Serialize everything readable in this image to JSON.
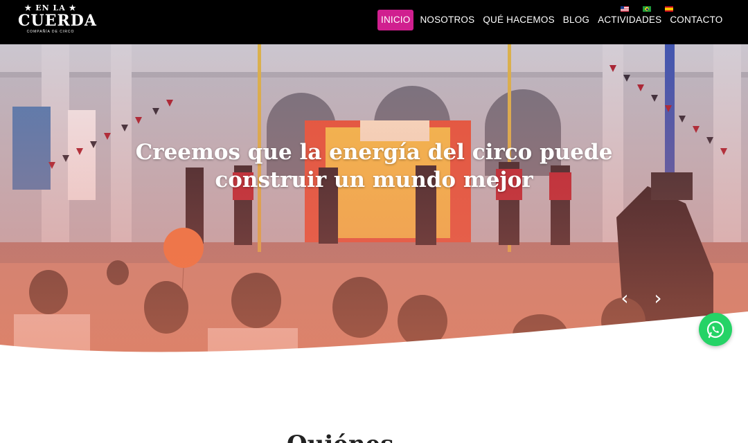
{
  "brand": {
    "logo_top": "★ EN LA ★",
    "logo_main": "CUERDA",
    "logo_sub": "COMPAÑÍA DE CIRCO"
  },
  "nav": {
    "items": [
      {
        "label": "INICIO",
        "active": true
      },
      {
        "label": "NOSOTROS",
        "active": false
      },
      {
        "label": "QUÉ HACEMOS",
        "active": false
      },
      {
        "label": "BLOG",
        "active": false
      },
      {
        "label": "ACTIVIDADES",
        "active": false
      },
      {
        "label": "CONTACTO",
        "active": false
      }
    ],
    "active_color": "#d01f8f"
  },
  "languages": [
    {
      "icon": "flag-us-icon"
    },
    {
      "icon": "flag-br-icon"
    },
    {
      "icon": "flag-es-icon"
    }
  ],
  "hero": {
    "title": "Creemos que la energía del circo puede construir un mundo mejor",
    "prev_icon": "chevron-left-icon",
    "next_icon": "chevron-right-icon",
    "prev_glyph": "‹",
    "next_glyph": "›"
  },
  "whatsapp": {
    "icon": "whatsapp-icon",
    "color": "#25d366"
  },
  "section": {
    "heading_partial": "Quiénes"
  }
}
